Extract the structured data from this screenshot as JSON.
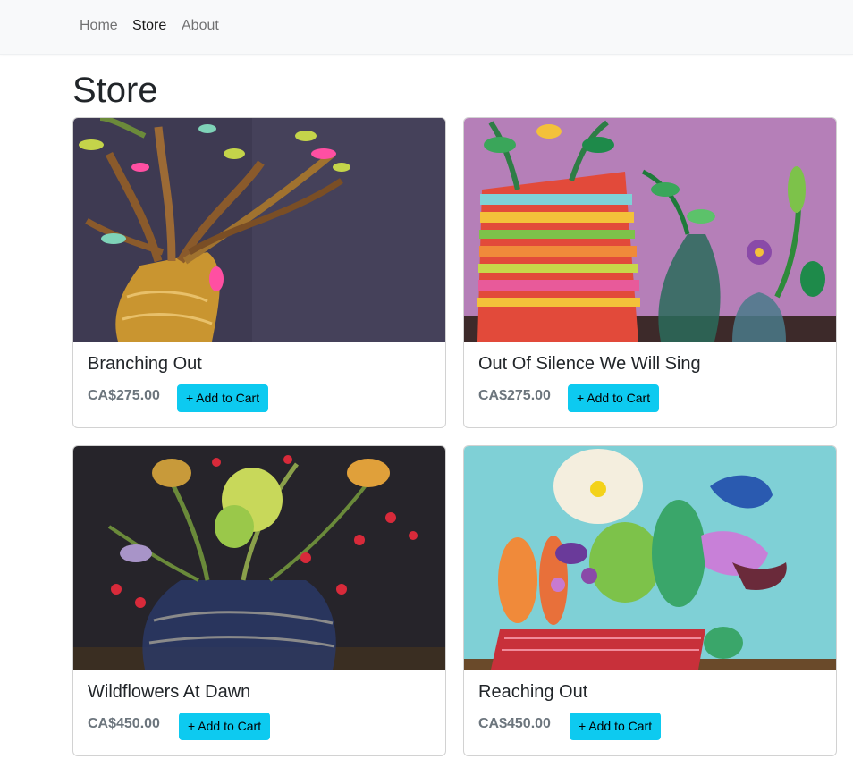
{
  "nav": {
    "home": "Home",
    "store": "Store",
    "about": "About"
  },
  "page": {
    "title": "Store"
  },
  "products": [
    {
      "title": "Branching Out",
      "price": "CA$275.00",
      "button": "+ Add to Cart"
    },
    {
      "title": "Out Of Silence We Will Sing",
      "price": "CA$275.00",
      "button": "+ Add to Cart"
    },
    {
      "title": "Wildflowers At Dawn",
      "price": "CA$450.00",
      "button": "+ Add to Cart"
    },
    {
      "title": "Reaching Out",
      "price": "CA$450.00",
      "button": "+ Add to Cart"
    }
  ],
  "colors": {
    "navbar_bg": "#f8f9fa",
    "button_bg": "#0dcaf0",
    "price_text": "#6c757d"
  }
}
